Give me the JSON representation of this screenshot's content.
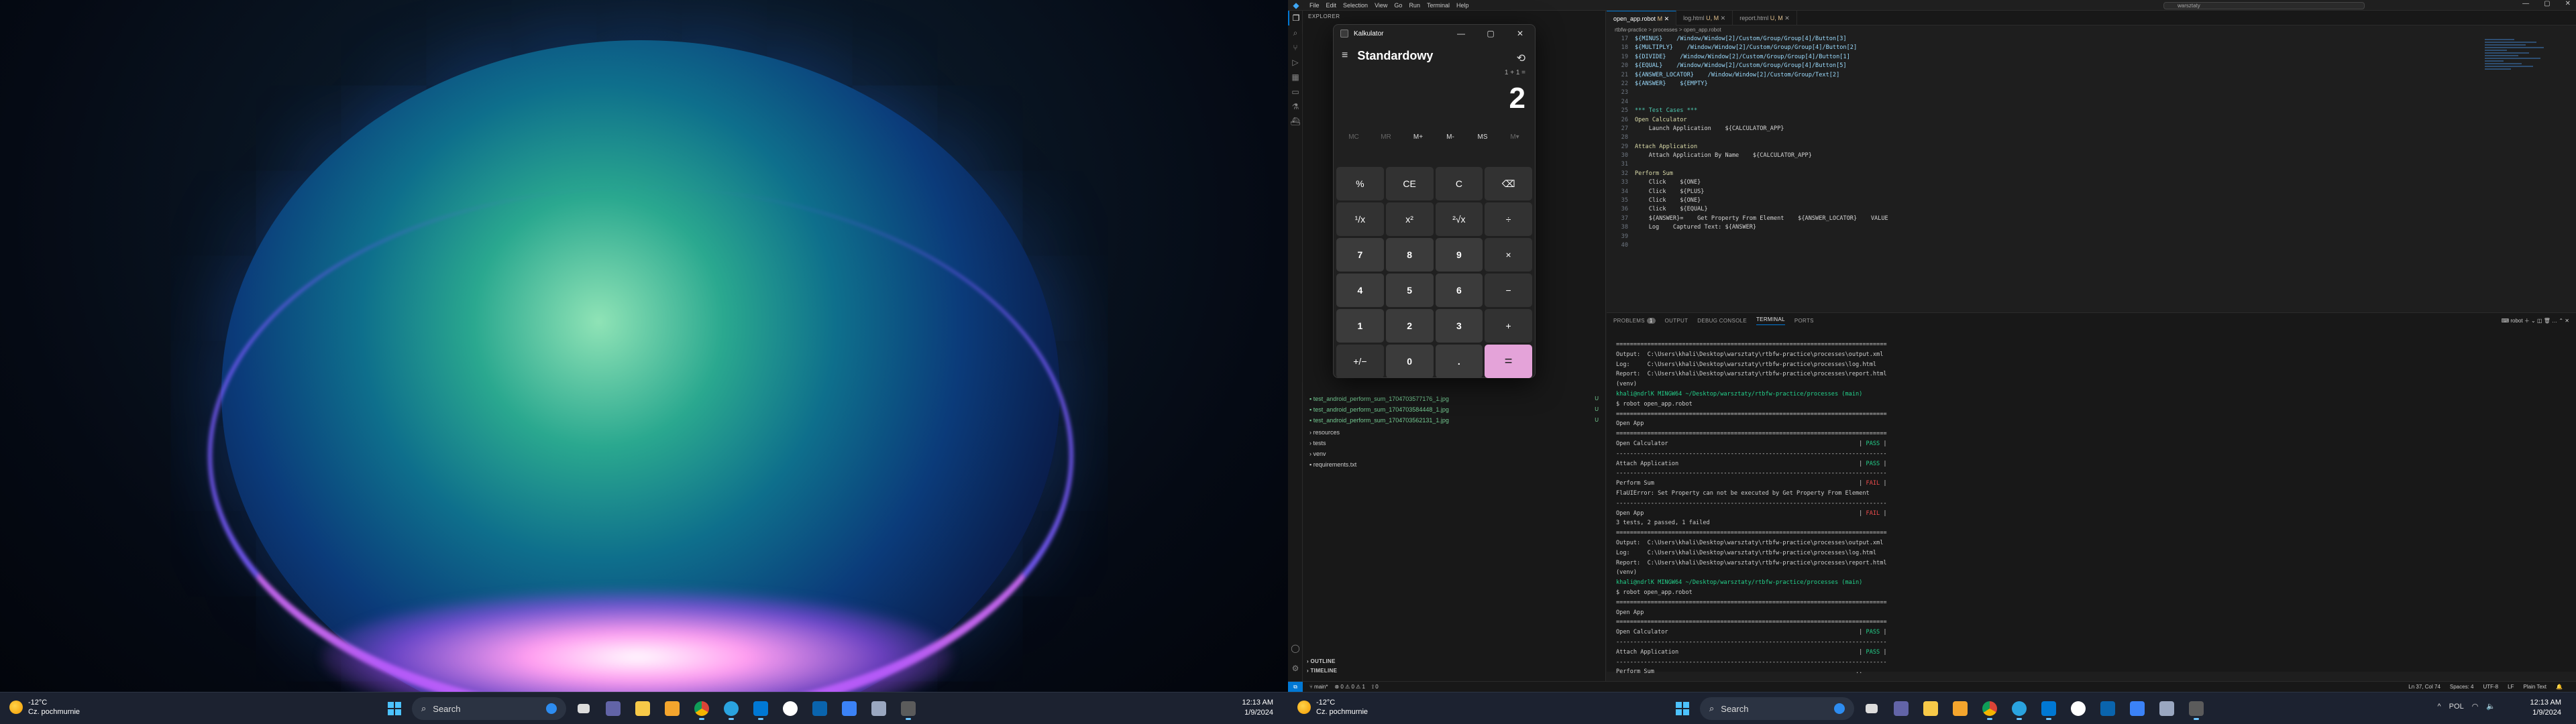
{
  "left_monitor": {
    "taskbar": {
      "weather": {
        "temp": "-12°C",
        "desc": "Cz. pochmurnie"
      },
      "search_placeholder": "Search",
      "apps": [
        "file-explorer-icon",
        "chrome-icon",
        "telegram-icon",
        "vscode-icon",
        "github-icon",
        "outlook-icon",
        "todo-icon",
        "tools-icon",
        "calculator-icon"
      ],
      "clock": {
        "time": "12:13 AM",
        "date": "1/9/2024"
      }
    }
  },
  "vscode": {
    "menu": [
      "File",
      "Edit",
      "Selection",
      "View",
      "Go",
      "Run",
      "Terminal",
      "Help"
    ],
    "command_center": "warsztaty",
    "tabs": [
      {
        "label": "open_app.robot",
        "mod": "M",
        "active": true
      },
      {
        "label": "log.html",
        "mod": "U, M",
        "active": false
      },
      {
        "label": "report.html",
        "mod": "U, M",
        "active": false
      }
    ],
    "breadcrumb": "rtbfw-practice > processes > open_app.robot",
    "explorer": {
      "files": [
        {
          "name": "test_android_perform_sum_1704703577176_1.jpg",
          "mark": "U"
        },
        {
          "name": "test_android_perform_sum_1704703584448_1.jpg",
          "mark": "U"
        },
        {
          "name": "test_android_perform_sum_1704703562131_1.jpg",
          "mark": "U"
        },
        {
          "name": "resources",
          "mark": ""
        },
        {
          "name": "tests",
          "mark": ""
        },
        {
          "name": "venv",
          "mark": ""
        },
        {
          "name": "requirements.txt",
          "mark": ""
        }
      ],
      "outline": "OUTLINE",
      "timeline": "TIMELINE"
    },
    "code_lines": [
      {
        "n": "17",
        "t": "${MINUS}    /Window/Window[2]/Custom/Group/Group[4]/Button[3]",
        "c": "v"
      },
      {
        "n": "18",
        "t": "${MULTIPLY}    /Window/Window[2]/Custom/Group/Group[4]/Button[2]",
        "c": "v"
      },
      {
        "n": "19",
        "t": "${DIVIDE}    /Window/Window[2]/Custom/Group/Group[4]/Button[1]",
        "c": "v"
      },
      {
        "n": "20",
        "t": "${EQUAL}    /Window/Window[2]/Custom/Group/Group[4]/Button[5]",
        "c": "v"
      },
      {
        "n": "21",
        "t": "${ANSWER_LOCATOR}    /Window/Window[2]/Custom/Group/Text[2]",
        "c": "v"
      },
      {
        "n": "22",
        "t": "${ANSWER}    ${EMPTY}",
        "c": "v"
      },
      {
        "n": "23",
        "t": "",
        "c": ""
      },
      {
        "n": "24",
        "t": "",
        "c": ""
      },
      {
        "n": "25",
        "t": "*** Test Cases ***",
        "c": "h"
      },
      {
        "n": "26",
        "t": "Open Calculator",
        "c": "t"
      },
      {
        "n": "27",
        "t": "    Launch Application    ${CALCULATOR_APP}",
        "c": ""
      },
      {
        "n": "28",
        "t": "",
        "c": ""
      },
      {
        "n": "29",
        "t": "Attach Application",
        "c": "t"
      },
      {
        "n": "30",
        "t": "    Attach Application By Name    ${CALCULATOR_APP}",
        "c": ""
      },
      {
        "n": "31",
        "t": "",
        "c": ""
      },
      {
        "n": "32",
        "t": "Perform Sum",
        "c": "t"
      },
      {
        "n": "33",
        "t": "    Click    ${ONE}",
        "c": ""
      },
      {
        "n": "34",
        "t": "    Click    ${PLUS}",
        "c": ""
      },
      {
        "n": "35",
        "t": "    Click    ${ONE}",
        "c": ""
      },
      {
        "n": "36",
        "t": "    Click    ${EQUAL}",
        "c": ""
      },
      {
        "n": "37",
        "t": "    ${ANSWER}=    Get Property From Element    ${ANSWER_LOCATOR}    VALUE",
        "c": ""
      },
      {
        "n": "38",
        "t": "    Log    Captured Text: ${ANSWER}",
        "c": ""
      },
      {
        "n": "39",
        "t": "",
        "c": ""
      },
      {
        "n": "40",
        "t": "",
        "c": ""
      }
    ],
    "panel_tabs": [
      "PROBLEMS",
      "OUTPUT",
      "DEBUG CONSOLE",
      "TERMINAL",
      "PORTS"
    ],
    "problems_count": "1",
    "terminal_profile": "robot",
    "terminal_lines": [
      {
        "t": "==============================================================================",
        "k": "sep"
      },
      {
        "t": "Output:  C:\\Users\\khali\\Desktop\\warsztaty\\rtbfw-practice\\processes\\output.xml",
        "k": ""
      },
      {
        "t": "Log:     C:\\Users\\khali\\Desktop\\warsztaty\\rtbfw-practice\\processes\\log.html",
        "k": ""
      },
      {
        "t": "Report:  C:\\Users\\khali\\Desktop\\warsztaty\\rtbfw-practice\\processes\\report.html",
        "k": ""
      },
      {
        "t": "(venv)",
        "k": ""
      },
      {
        "t": "khali@ndrlK MINGW64 ~/Desktop/warsztaty/rtbfw-practice/processes (main)",
        "k": "prompt"
      },
      {
        "t": "$ robot open_app.robot",
        "k": ""
      },
      {
        "t": "==============================================================================",
        "k": "sep"
      },
      {
        "t": "Open App",
        "k": ""
      },
      {
        "t": "==============================================================================",
        "k": "sep"
      },
      {
        "t": "Open Calculator                                                       | PASS |",
        "k": "pass"
      },
      {
        "t": "------------------------------------------------------------------------------",
        "k": "sep"
      },
      {
        "t": "Attach Application                                                    | PASS |",
        "k": "pass"
      },
      {
        "t": "------------------------------------------------------------------------------",
        "k": "sep"
      },
      {
        "t": "Perform Sum                                                           | FAIL |",
        "k": "fail"
      },
      {
        "t": "FlaUIError: Set Property can not be executed by Get Property From Element",
        "k": ""
      },
      {
        "t": "------------------------------------------------------------------------------",
        "k": "sep"
      },
      {
        "t": "Open App                                                              | FAIL |",
        "k": "fail"
      },
      {
        "t": "3 tests, 2 passed, 1 failed",
        "k": ""
      },
      {
        "t": "==============================================================================",
        "k": "sep"
      },
      {
        "t": "Output:  C:\\Users\\khali\\Desktop\\warsztaty\\rtbfw-practice\\processes\\output.xml",
        "k": ""
      },
      {
        "t": "Log:     C:\\Users\\khali\\Desktop\\warsztaty\\rtbfw-practice\\processes\\log.html",
        "k": ""
      },
      {
        "t": "Report:  C:\\Users\\khali\\Desktop\\warsztaty\\rtbfw-practice\\processes\\report.html",
        "k": ""
      },
      {
        "t": "(venv)",
        "k": ""
      },
      {
        "t": "khali@ndrlK MINGW64 ~/Desktop/warsztaty/rtbfw-practice/processes (main)",
        "k": "prompt"
      },
      {
        "t": "$ robot open_app.robot",
        "k": ""
      },
      {
        "t": "==============================================================================",
        "k": "sep"
      },
      {
        "t": "Open App",
        "k": ""
      },
      {
        "t": "==============================================================================",
        "k": "sep"
      },
      {
        "t": "Open Calculator                                                       | PASS |",
        "k": "pass"
      },
      {
        "t": "------------------------------------------------------------------------------",
        "k": "sep"
      },
      {
        "t": "Attach Application                                                    | PASS |",
        "k": "pass"
      },
      {
        "t": "------------------------------------------------------------------------------",
        "k": "sep"
      },
      {
        "t": "Perform Sum                                                          ..",
        "k": ""
      }
    ],
    "status": {
      "branch": "main*",
      "problems": "0 ⚠ 0 ⚠ 1",
      "ports": "0",
      "position": "Ln 37, Col 74",
      "spaces": "Spaces: 4",
      "encoding": "UTF-8",
      "eol": "LF",
      "language": "Plain Text"
    }
  },
  "calculator": {
    "title": "Kalkulator",
    "mode": "Standardowy",
    "expression": "1 + 1 =",
    "display": "2",
    "memory": [
      "MC",
      "MR",
      "M+",
      "M-",
      "MS",
      "M▾"
    ],
    "keys": [
      {
        "label": "%",
        "type": "op"
      },
      {
        "label": "CE",
        "type": "op"
      },
      {
        "label": "C",
        "type": "op"
      },
      {
        "label": "⌫",
        "type": "op"
      },
      {
        "label": "¹/x",
        "type": "op"
      },
      {
        "label": "x²",
        "type": "op"
      },
      {
        "label": "²√x",
        "type": "op"
      },
      {
        "label": "÷",
        "type": "op"
      },
      {
        "label": "7",
        "type": "num"
      },
      {
        "label": "8",
        "type": "num"
      },
      {
        "label": "9",
        "type": "num"
      },
      {
        "label": "×",
        "type": "op"
      },
      {
        "label": "4",
        "type": "num"
      },
      {
        "label": "5",
        "type": "num"
      },
      {
        "label": "6",
        "type": "num"
      },
      {
        "label": "−",
        "type": "op"
      },
      {
        "label": "1",
        "type": "num"
      },
      {
        "label": "2",
        "type": "num"
      },
      {
        "label": "3",
        "type": "num"
      },
      {
        "label": "+",
        "type": "op"
      },
      {
        "label": "+/−",
        "type": "op"
      },
      {
        "label": "0",
        "type": "num"
      },
      {
        "label": ".",
        "type": "num"
      },
      {
        "label": "=",
        "type": "eq"
      }
    ],
    "accent": "#e4a3d9"
  },
  "right_monitor": {
    "taskbar": {
      "weather": {
        "temp": "-12°C",
        "desc": "Cz. pochmurnie"
      },
      "search_placeholder": "Search",
      "tray": [
        "^",
        "POL"
      ],
      "clock": {
        "time": "12:13 AM",
        "date": "1/9/2024"
      }
    }
  }
}
